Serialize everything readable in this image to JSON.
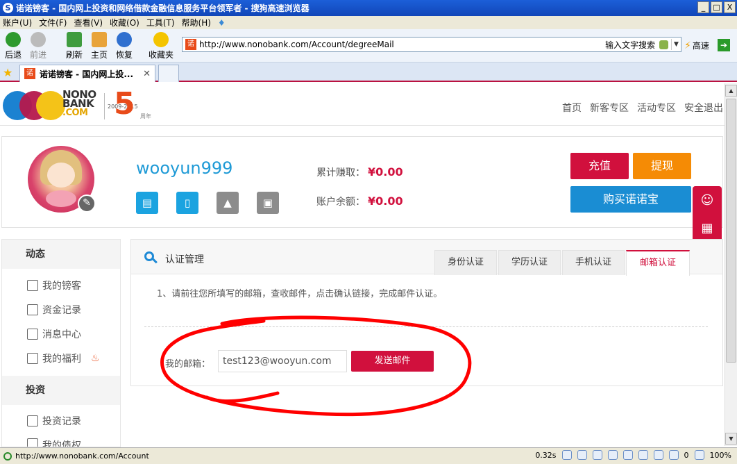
{
  "window": {
    "title": "诺诺镑客 - 国内网上投资和网络借款金融信息服务平台领军者 - 搜狗高速浏览器",
    "minimize": "_",
    "maximize": "□",
    "close": "X"
  },
  "menu": [
    "账户(U)",
    "文件(F)",
    "查看(V)",
    "收藏(O)",
    "工具(T)",
    "帮助(H)"
  ],
  "toolbar": {
    "back": "后退",
    "forward": "前进",
    "refresh": "刷新",
    "home": "主页",
    "restore": "恢复",
    "favorites": "收藏夹"
  },
  "address": {
    "url": "http://www.nonobank.com/Account/degreeMail",
    "search_hint": "输入文字搜索",
    "speed": "高速"
  },
  "tab": {
    "favicon": "诺",
    "title": "诺诺镑客 - 国内网上投..."
  },
  "logo": {
    "nono": "NONO",
    "bank": "BANK",
    "com": ".COM",
    "years": "2009-2015",
    "five": "5",
    "zhounian": "周年"
  },
  "nav": [
    "首页",
    "新客专区",
    "活动专区",
    "安全退出"
  ],
  "profile": {
    "username": "wooyun999",
    "earned_label": "累计赚取：",
    "earned_value": "¥0.00",
    "balance_label": "账户余额：",
    "balance_value": "¥0.00",
    "recharge": "充值",
    "withdraw": "提现",
    "buy": "购买诺诺宝"
  },
  "sidebar": {
    "dynamic": "动态",
    "items": [
      "我的镑客",
      "资金记录",
      "消息中心",
      "我的福利"
    ],
    "invest": "投资",
    "invest_items": [
      "投资记录",
      "我的债权"
    ]
  },
  "main": {
    "title": "认证管理",
    "tabs": [
      "身份认证",
      "学历认证",
      "手机认证",
      "邮箱认证"
    ],
    "instruction": "1、请前往您所填写的邮箱，查收邮件，点击确认链接，完成邮件认证。",
    "email_label": "我的邮箱：",
    "email_value": "test123@wooyun.com",
    "send_button": "发送邮件"
  },
  "status": {
    "url": "http://www.nonobank.com/Account",
    "time": "0.32s",
    "count": "0",
    "zoom": "100%"
  },
  "colors": {
    "brand_red": "#d1103d",
    "brand_blue": "#1a8dd3",
    "orange": "#f58b05",
    "annotation_red": "#ff0000"
  }
}
